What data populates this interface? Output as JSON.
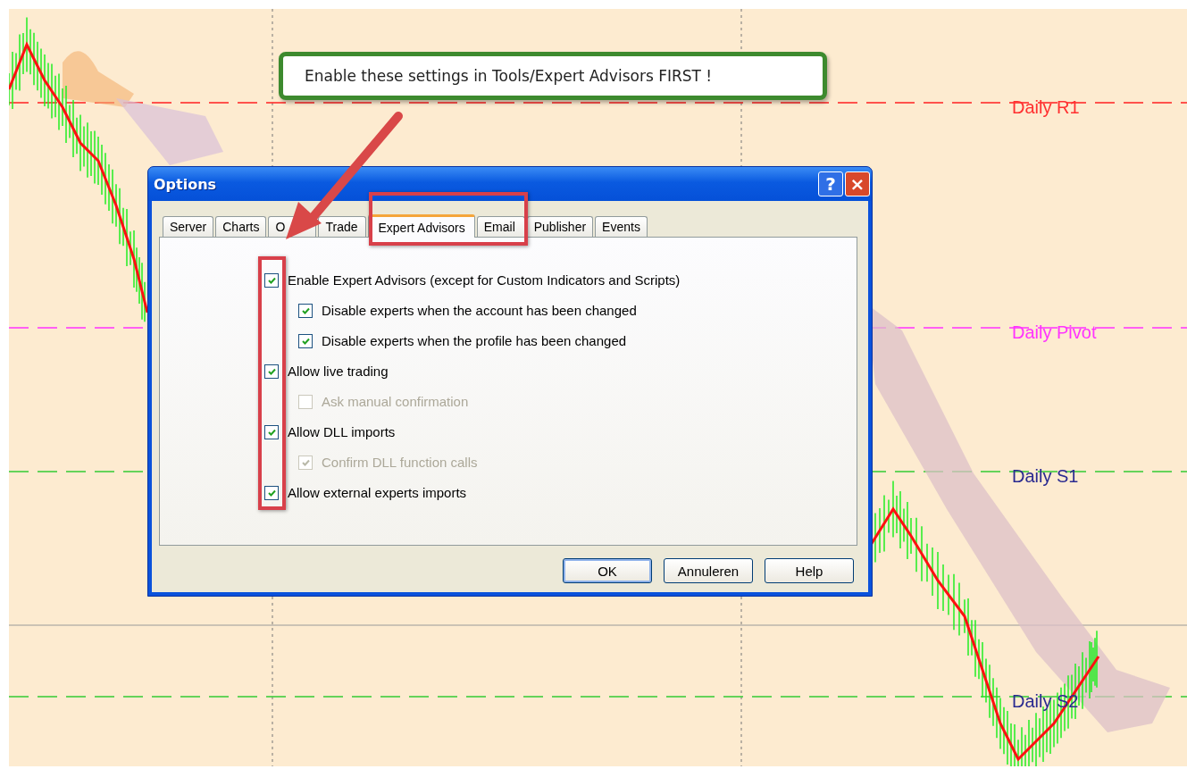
{
  "chart": {
    "levels": [
      {
        "label": "Daily R1",
        "kind": "resistance",
        "color": "#ff3030"
      },
      {
        "label": "Daily Pivot",
        "kind": "pivot",
        "color": "#ff33ff"
      },
      {
        "label": "Daily S1",
        "kind": "support",
        "color": "#2a2a90"
      },
      {
        "label": "Daily S2",
        "kind": "support",
        "color": "#2a2a90"
      }
    ]
  },
  "callout": {
    "text": "Enable these settings in Tools/Expert Advisors FIRST !"
  },
  "dialog": {
    "title": "Options",
    "title_buttons": [
      {
        "kind": "help",
        "glyph": "?"
      },
      {
        "kind": "close",
        "glyph": "×"
      }
    ],
    "tabs": [
      {
        "label": "Server",
        "selected": false
      },
      {
        "label": "Charts",
        "selected": false
      },
      {
        "label": "O",
        "selected": false
      },
      {
        "label": "Trade",
        "selected": false
      },
      {
        "label": "Expert Advisors",
        "selected": true
      },
      {
        "label": "Email",
        "selected": false
      },
      {
        "label": "Publisher",
        "selected": false
      },
      {
        "label": "Events",
        "selected": false
      }
    ],
    "options": [
      {
        "label": "Enable Expert Advisors (except for Custom Indicators and Scripts)",
        "checked": true,
        "disabled": false,
        "children": [
          {
            "label": "Disable experts when the account has been changed",
            "checked": true,
            "disabled": false
          },
          {
            "label": "Disable experts when the profile has been changed",
            "checked": true,
            "disabled": false
          }
        ]
      },
      {
        "label": "Allow live trading",
        "checked": true,
        "disabled": false,
        "children": [
          {
            "label": "Ask manual confirmation",
            "checked": false,
            "disabled": true
          }
        ]
      },
      {
        "label": "Allow DLL imports",
        "checked": true,
        "disabled": false,
        "children": [
          {
            "label": "Confirm DLL function calls",
            "checked": true,
            "disabled": true
          }
        ]
      },
      {
        "label": "Allow external experts imports",
        "checked": true,
        "disabled": false
      }
    ],
    "buttons": [
      {
        "label": "OK",
        "kind": "default"
      },
      {
        "label": "Annuleren",
        "kind": "normal"
      },
      {
        "label": "Help",
        "kind": "normal"
      }
    ]
  }
}
